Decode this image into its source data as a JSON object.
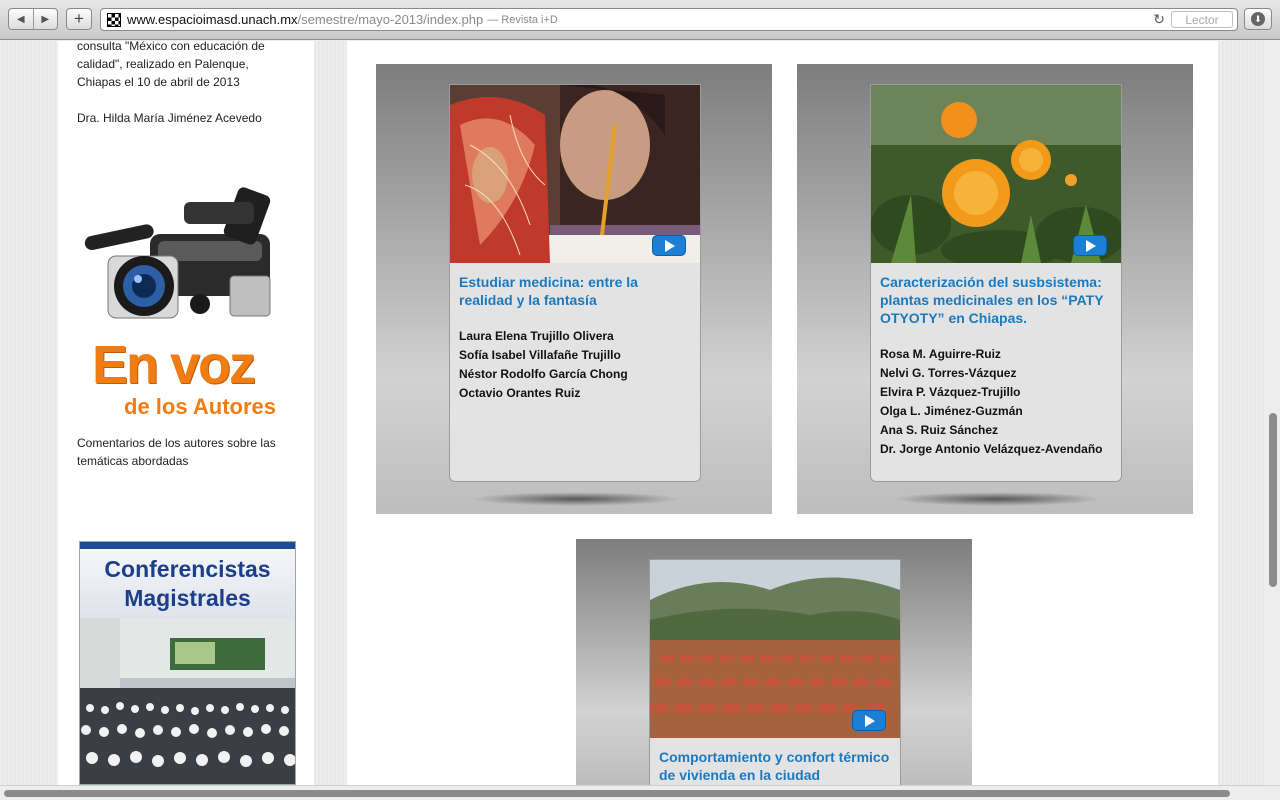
{
  "browser": {
    "back_icon": "◀",
    "forward_icon": "▶",
    "add_icon": "+",
    "url_domain": "www.espacioimasd.unach.mx",
    "url_path": "/semestre/mayo-2013/index.php",
    "url_title": "— Revista i+D",
    "reload_icon": "↻",
    "reader_label": "Lector",
    "download_icon": "⬇"
  },
  "sidebar": {
    "event_text": "consulta \"México con educación de calidad\", realizado en Palenque, Chiapas el 10 de abril de 2013",
    "author": "Dra. Hilda María Jiménez Acevedo",
    "logo_line1": "En voz",
    "logo_line2": "de los Autores",
    "comments_text": "Comentarios de los autores sobre las temáticas abordadas",
    "banner_line1": "Conferencistas",
    "banner_line2": "Magistrales"
  },
  "articles": [
    {
      "title": "Estudiar medicina: entre la realidad y la fantasía",
      "authors": [
        "Laura Elena Trujillo Olivera",
        "Sofía Isabel Villafañe Trujillo",
        "Néstor Rodolfo García Chong",
        "Octavio Orantes Ruiz"
      ]
    },
    {
      "title": "Caracterización del susbsistema: plantas medicinales en los “PATY OTYOTY” en Chiapas.",
      "authors": [
        "Rosa M. Aguirre-Ruiz",
        "Nelvi G. Torres-Vázquez",
        "Elvira P. Vázquez-Trujillo",
        "Olga L. Jiménez-Guzmán",
        "Ana S. Ruiz Sánchez",
        "Dr. Jorge Antonio Velázquez-Avendaño"
      ]
    },
    {
      "title": "Comportamiento y confort térmico de vivienda en la ciudad",
      "authors": []
    }
  ],
  "colors": {
    "link_blue": "#1b79bf",
    "logo_orange": "#f07d14",
    "banner_blue": "#1b3f8a",
    "play_blue": "#1d7fd4"
  }
}
